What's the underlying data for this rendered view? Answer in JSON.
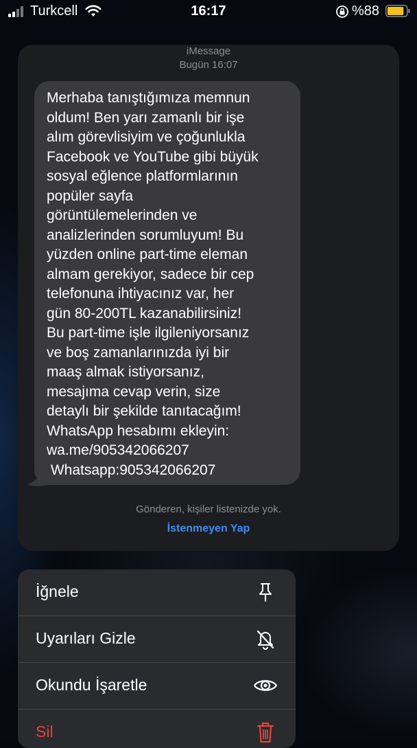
{
  "status_bar": {
    "carrier": "Turkcell",
    "time": "16:17",
    "battery_percent": "%88",
    "battery_level": 0.88
  },
  "message_card": {
    "service": "iMessage",
    "date": "Bugün 16:07",
    "message_lines": [
      "Merhaba tanıştığımıza memnun",
      "oldum! Ben yarı zamanlı bir işe",
      "alım görevlisiyim ve çoğunlukla",
      "Facebook ve YouTube gibi büyük",
      "sosyal eğlence platformlarının",
      "popüler sayfa",
      "görüntülemelerinden ve",
      "analizlerinden sorumluyum! Bu",
      "yüzden online part-time eleman",
      "almam gerekiyor, sadece bir cep",
      "telefonuna ihtiyacınız var, her",
      "gün 80-200TL kazanabilirsiniz!",
      "Bu part-time işle ilgileniyorsanız",
      "ve boş zamanlarınızda iyi bir",
      "maaş almak istiyorsanız,",
      "mesajıma cevap verin, size",
      "detaylı bir şekilde tanıtacağım!",
      "WhatsApp hesabımı ekleyin:",
      "wa.me/905342066207",
      " Whatsapp:905342066207"
    ],
    "sender_note": "Gönderen, kişiler listenizde yok.",
    "report_junk": "İstenmeyen Yap"
  },
  "context_menu": {
    "items": [
      {
        "label": "İğnele",
        "icon": "pin-icon"
      },
      {
        "label": "Uyarıları Gizle",
        "icon": "bell-slash-icon"
      },
      {
        "label": "Okundu İşaretle",
        "icon": "eye-icon"
      },
      {
        "label": "Sil",
        "icon": "trash-icon"
      }
    ]
  },
  "colors": {
    "accent_link": "#3e8cf1",
    "destructive": "#e5443a",
    "bubble": "#3a3a3d",
    "battery": "#f2c31c"
  }
}
